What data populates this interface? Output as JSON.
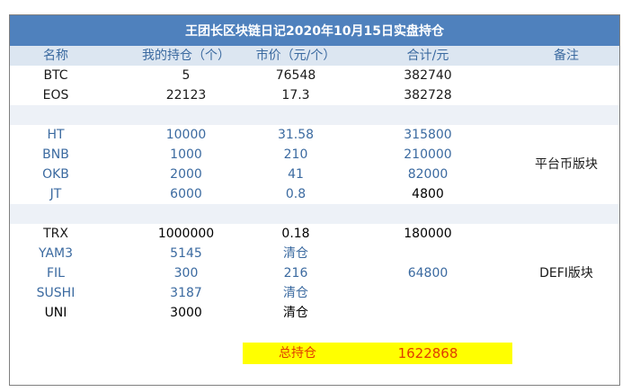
{
  "title": "王团长区块链日记2020年10月15日实盘持仓",
  "headers": {
    "name": "名称",
    "qty": "我的持仓（个）",
    "price": "市价（元/个）",
    "total": "合计/元",
    "note": "备注"
  },
  "rows": [
    {
      "name": "BTC",
      "qty": "5",
      "price": "76548",
      "total": "382740"
    },
    {
      "name": "EOS",
      "qty": "22123",
      "price": "17.3",
      "total": "382728"
    },
    {
      "name": "HT",
      "qty": "10000",
      "price": "31.58",
      "total": "315800"
    },
    {
      "name": "BNB",
      "qty": "1000",
      "price": "210",
      "total": "210000"
    },
    {
      "name": "OKB",
      "qty": "2000",
      "price": "41",
      "total": "82000"
    },
    {
      "name": "JT",
      "qty": "6000",
      "price": "0.8",
      "total": "4800"
    },
    {
      "name": "TRX",
      "qty": "1000000",
      "price": "0.18",
      "total": "180000"
    },
    {
      "name": "YAM3",
      "qty": "5145",
      "price": "清仓",
      "total": ""
    },
    {
      "name": "FIL",
      "qty": "300",
      "price": "216",
      "total": "64800"
    },
    {
      "name": "SUSHI",
      "qty": "3187",
      "price": "清仓",
      "total": ""
    },
    {
      "name": "UNI",
      "qty": "3000",
      "price": "清仓",
      "total": ""
    }
  ],
  "notes": {
    "platform": "平台币版块",
    "defi": "DEFI版块"
  },
  "summary": {
    "label": "总持仓",
    "value": "1622868"
  },
  "colors": {
    "title_bg": "#4f81bd",
    "header_bg": "#dce6f1",
    "gap_bg": "#edf1f7",
    "text_blue": "#3b6aa0",
    "highlight": "#ffff00",
    "total_text": "#e03c00"
  }
}
